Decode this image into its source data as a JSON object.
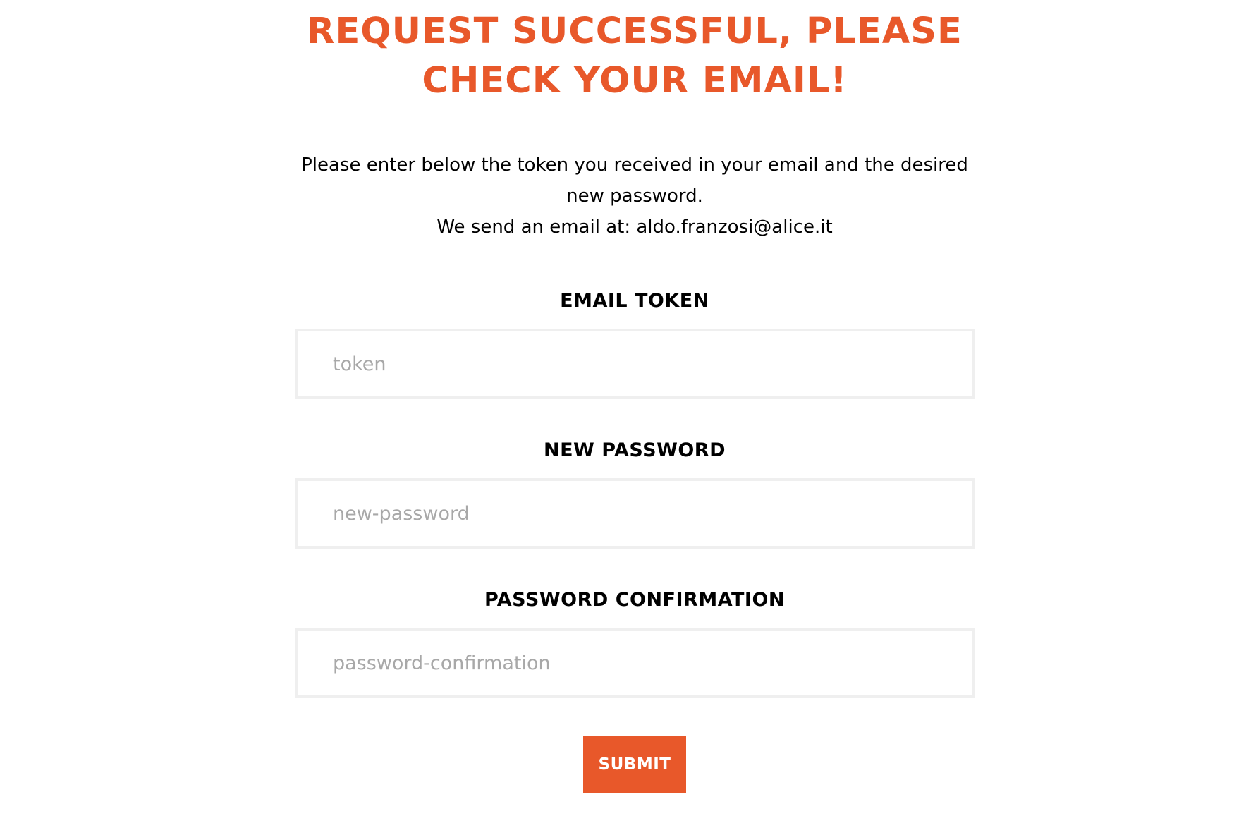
{
  "page": {
    "title": "REQUEST SUCCESSFUL, PLEASE CHECK YOUR EMAIL!",
    "intro_line_1": "Please enter below the token you received in your email and the desired new password.",
    "intro_line_2": "We send an email at: aldo.franzosi@alice.it"
  },
  "form": {
    "token": {
      "label": "EMAIL TOKEN",
      "placeholder": "token",
      "value": ""
    },
    "new_password": {
      "label": "NEW PASSWORD",
      "placeholder": "new-password",
      "value": ""
    },
    "password_confirmation": {
      "label": "PASSWORD CONFIRMATION",
      "placeholder": "password-confirmation",
      "value": ""
    },
    "submit_label": "SUBMIT"
  },
  "colors": {
    "accent": "#e8582a",
    "input_border": "#efefef",
    "placeholder": "#a8a8a8"
  }
}
